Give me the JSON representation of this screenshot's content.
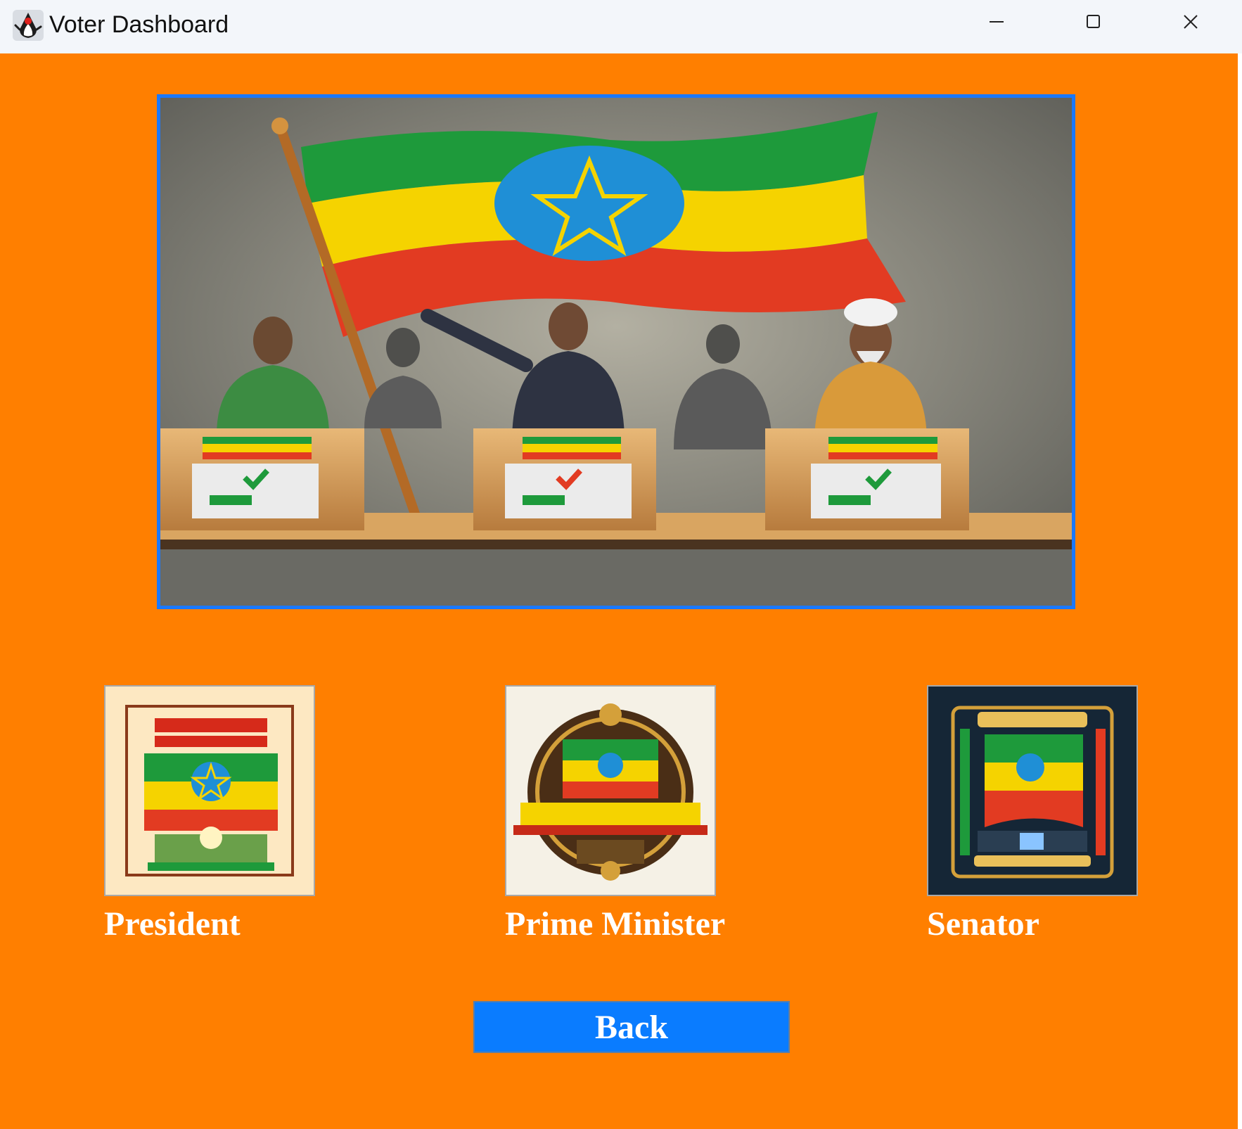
{
  "window": {
    "title": "Voter Dashboard",
    "icon": "java-duke-icon",
    "controls": {
      "minimize_icon": "minimize-icon",
      "maximize_icon": "maximize-icon",
      "close_icon": "close-icon"
    }
  },
  "colors": {
    "background": "#ff7f00",
    "accent": "#0a7cff",
    "hero_border": "#1a78ff",
    "label_text": "#ffffff"
  },
  "hero": {
    "image": "ethiopian-election-illustration"
  },
  "positions": [
    {
      "label": "President",
      "image": "president-emblem"
    },
    {
      "label": "Prime Minister",
      "image": "prime-minister-emblem"
    },
    {
      "label": "Senator",
      "image": "senator-emblem"
    }
  ],
  "back_button": {
    "label": "Back"
  }
}
